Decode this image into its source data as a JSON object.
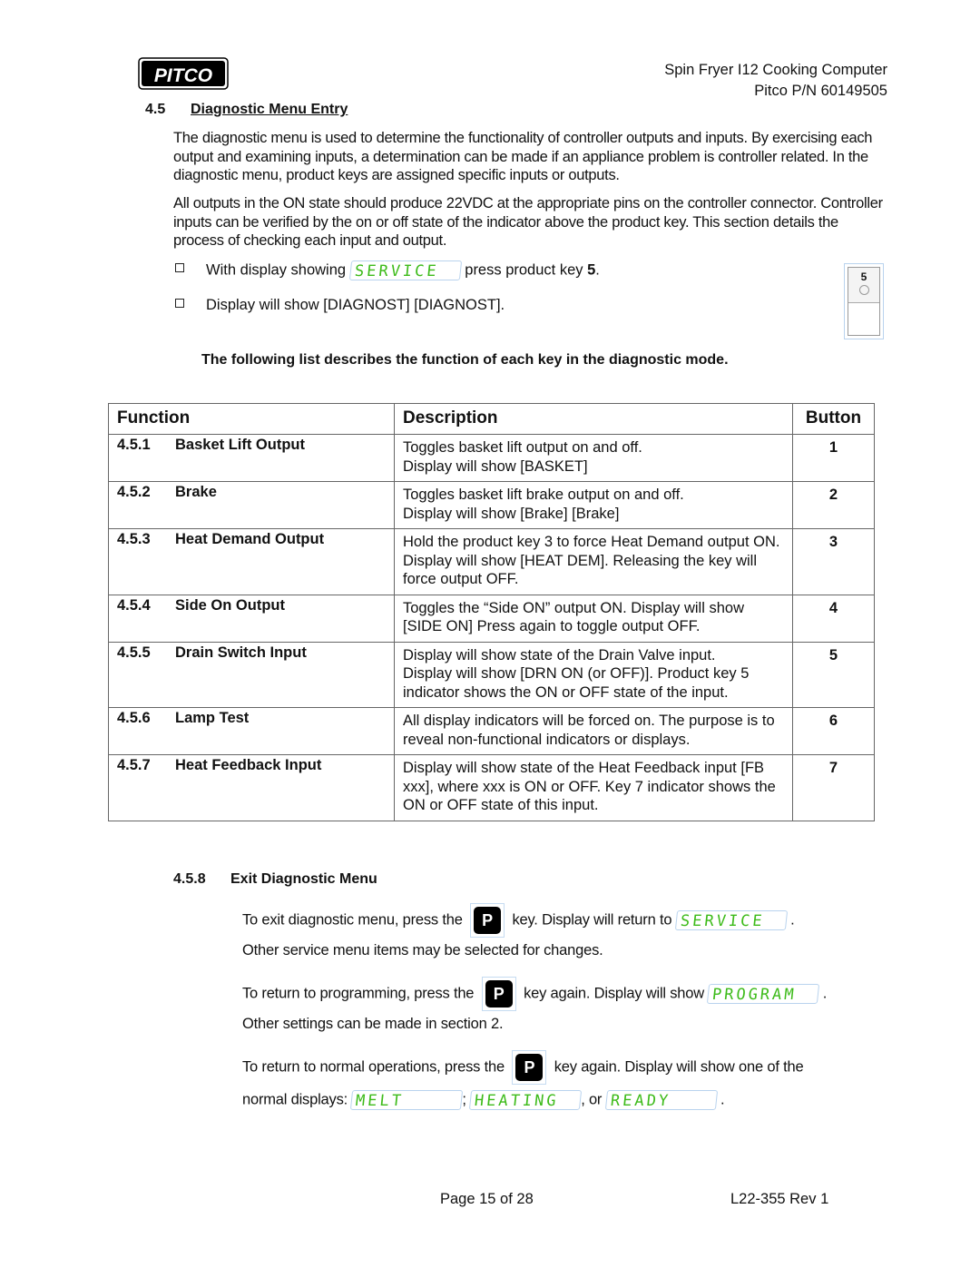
{
  "header": {
    "logo_text": "PITCO",
    "doc_title": "Spin Fryer I12 Cooking Computer",
    "part_number": "Pitco P/N 60149505"
  },
  "section": {
    "number": "4.5",
    "title": "Diagnostic Menu Entry",
    "paragraphs": [
      "The diagnostic menu is used to determine the functionality of controller outputs and inputs.  By exercising each output and examining inputs, a determination can be made if an appliance problem is controller related.  In the diagnostic menu, product keys are assigned specific inputs or outputs.",
      "All outputs in the ON state should produce 22VDC at the appropriate pins on the controller connector.  Controller inputs can be verified by the on or off state of the indicator above the product key.  This section details the process of checking each input and output."
    ],
    "steps": [
      {
        "before": "With display showing",
        "display": "SERVICE",
        "after": "press product key",
        "key": "5",
        "end": "."
      },
      {
        "text": "Display will show [DIAGNOST] [DIAGNOST]."
      }
    ],
    "key_illustration_label": "5",
    "lead_text": "The following list describes the function of each key in the diagnostic mode."
  },
  "table": {
    "headers": {
      "function": "Function",
      "description": "Description",
      "button": "Button"
    },
    "rows": [
      {
        "num": "4.5.1",
        "name": "Basket Lift Output",
        "desc": "Toggles basket lift output on and off.\nDisplay will show [BASKET]",
        "button": "1"
      },
      {
        "num": "4.5.2",
        "name": "Brake",
        "desc": "Toggles basket lift brake output on and off.\nDisplay will show [Brake] [Brake]",
        "button": "2"
      },
      {
        "num": "4.5.3",
        "name": "Heat Demand Output",
        "desc": "Hold the product key 3 to force Heat Demand output ON. Display will show [HEAT DEM].  Releasing the key will force output OFF.",
        "button": "3"
      },
      {
        "num": "4.5.4",
        "name": "Side On Output",
        "desc": "Toggles the “Side ON” output ON. Display will show [SIDE ON]  Press again to toggle output OFF.",
        "button": "4"
      },
      {
        "num": "4.5.5",
        "name": "Drain Switch Input",
        "desc": "Display will show state of the Drain Valve input.\nDisplay will show [DRN ON (or OFF)].  Product key 5 indicator shows the ON or OFF state of the input.",
        "button": "5"
      },
      {
        "num": "4.5.6",
        "name": "Lamp Test",
        "desc": "All display indicators will be forced on.  The purpose is to reveal non-functional indicators or displays.",
        "button": "6"
      },
      {
        "num": "4.5.7",
        "name": "Heat Feedback Input",
        "desc": "Display will show state of the Heat Feedback input [FB xxx], where xxx is ON or OFF.  Key 7 indicator shows the ON or OFF state of this input.",
        "button": "7"
      }
    ]
  },
  "exit": {
    "number": "4.5.8",
    "title": "Exit Diagnostic Menu",
    "p_key_label": "P",
    "line1a": "To exit diagnostic menu, press the",
    "line1b": "key.  Display will return to",
    "line1_display": "SERVICE",
    "line2": "Other service menu items may be selected for changes.",
    "line3a": "To return to programming, press the",
    "line3b": "key again.  Display will show",
    "line3_display": "PROGRAM",
    "line4": "Other settings can be made in section 2.",
    "line5a": "To return to normal operations, press the",
    "line5b": "key again. Display will show one of the",
    "line6a": "normal displays:",
    "normal_displays": [
      "MELT",
      "HEATING",
      "READY"
    ],
    "sep1": ";",
    "sep2": ", or",
    "period": "."
  },
  "footer": {
    "page": "Page 15 of 28",
    "doc_rev": "L22-355 Rev 1"
  },
  "colors": {
    "lcd_text": "#3dbb1a",
    "lcd_border": "#b9d3ee"
  }
}
